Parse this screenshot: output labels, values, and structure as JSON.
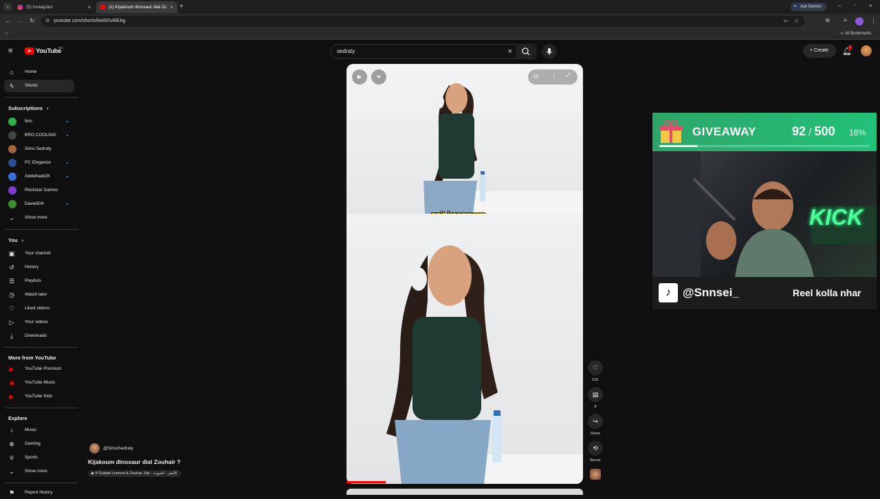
{
  "browser": {
    "tabs": [
      {
        "title": "(5) Instagram",
        "active": false
      },
      {
        "title": "(1) Kijakoum dinosaur dial Zou...",
        "active": true
      }
    ],
    "url": "youtube.com/shorts/liwW2u6iEAg",
    "ask_gemini": "Ask Gemini",
    "all_bookmarks": "All Bookmarks"
  },
  "header": {
    "logo_text": "YouTube",
    "logo_sup": "MA",
    "search_value": "sedraty",
    "create_label": "Create",
    "notifications_count": "1"
  },
  "sidebar": {
    "main": [
      {
        "label": "Home",
        "icon": "home-icon"
      },
      {
        "label": "Shorts",
        "icon": "shorts-icon",
        "active": true
      }
    ],
    "subscriptions_title": "Subscriptions",
    "subscriptions": [
      {
        "label": "fem",
        "color": "#2bb24c",
        "dot": true
      },
      {
        "label": "BRO COOLING",
        "color": "#555",
        "dot": true
      },
      {
        "label": "Simo Sedraty",
        "color": "#a0673f",
        "dot": false
      },
      {
        "label": "PC Elegance",
        "color": "#2c4f8f",
        "dot": true
      },
      {
        "label": "Abdelhadi2K",
        "color": "#3a6fd8",
        "dot": true
      },
      {
        "label": "Rockstar Games",
        "color": "#7b3ccf",
        "dot": false
      },
      {
        "label": "Davie504",
        "color": "#3c8e2e",
        "dot": true
      }
    ],
    "show_more": "Show more",
    "you_title": "You",
    "you": [
      {
        "label": "Your channel",
        "icon": "channel-icon"
      },
      {
        "label": "History",
        "icon": "history-icon"
      },
      {
        "label": "Playlists",
        "icon": "playlists-icon"
      },
      {
        "label": "Watch later",
        "icon": "watch-later-icon"
      },
      {
        "label": "Liked videos",
        "icon": "liked-icon"
      },
      {
        "label": "Your videos",
        "icon": "your-videos-icon"
      },
      {
        "label": "Downloads",
        "icon": "download-icon"
      }
    ],
    "more_title": "More from YouTube",
    "more": [
      {
        "label": "YouTube Premium"
      },
      {
        "label": "YouTube Music"
      },
      {
        "label": "YouTube Kids"
      }
    ],
    "explore_title": "Explore",
    "explore": [
      {
        "label": "Music",
        "icon": "music-icon"
      },
      {
        "label": "Gaming",
        "icon": "gaming-icon"
      },
      {
        "label": "Sports",
        "icon": "sports-icon"
      }
    ],
    "explore_show_more": "Show more",
    "report_history": "Report history"
  },
  "short": {
    "caption": "nsit kansawro",
    "channel": "@SimoSedraty",
    "title": "Kijakoum dinosaur dial Zouhair ?",
    "music": "ft Ouidad Lemnini & Zouhair Zair · الأصل · الصوت",
    "like_count": "532",
    "comment_count": "8",
    "share_label": "Share",
    "remix_label": "Remix"
  },
  "overlay": {
    "giveaway_label": "GIVEAWAY",
    "giveaway_count": "92",
    "giveaway_total": "500",
    "giveaway_percent": "18%",
    "giveaway_fraction": 0.184,
    "handle": "@Snnsei_",
    "tagline": "Reel kolla nhar",
    "neon_sign": "KICK"
  }
}
